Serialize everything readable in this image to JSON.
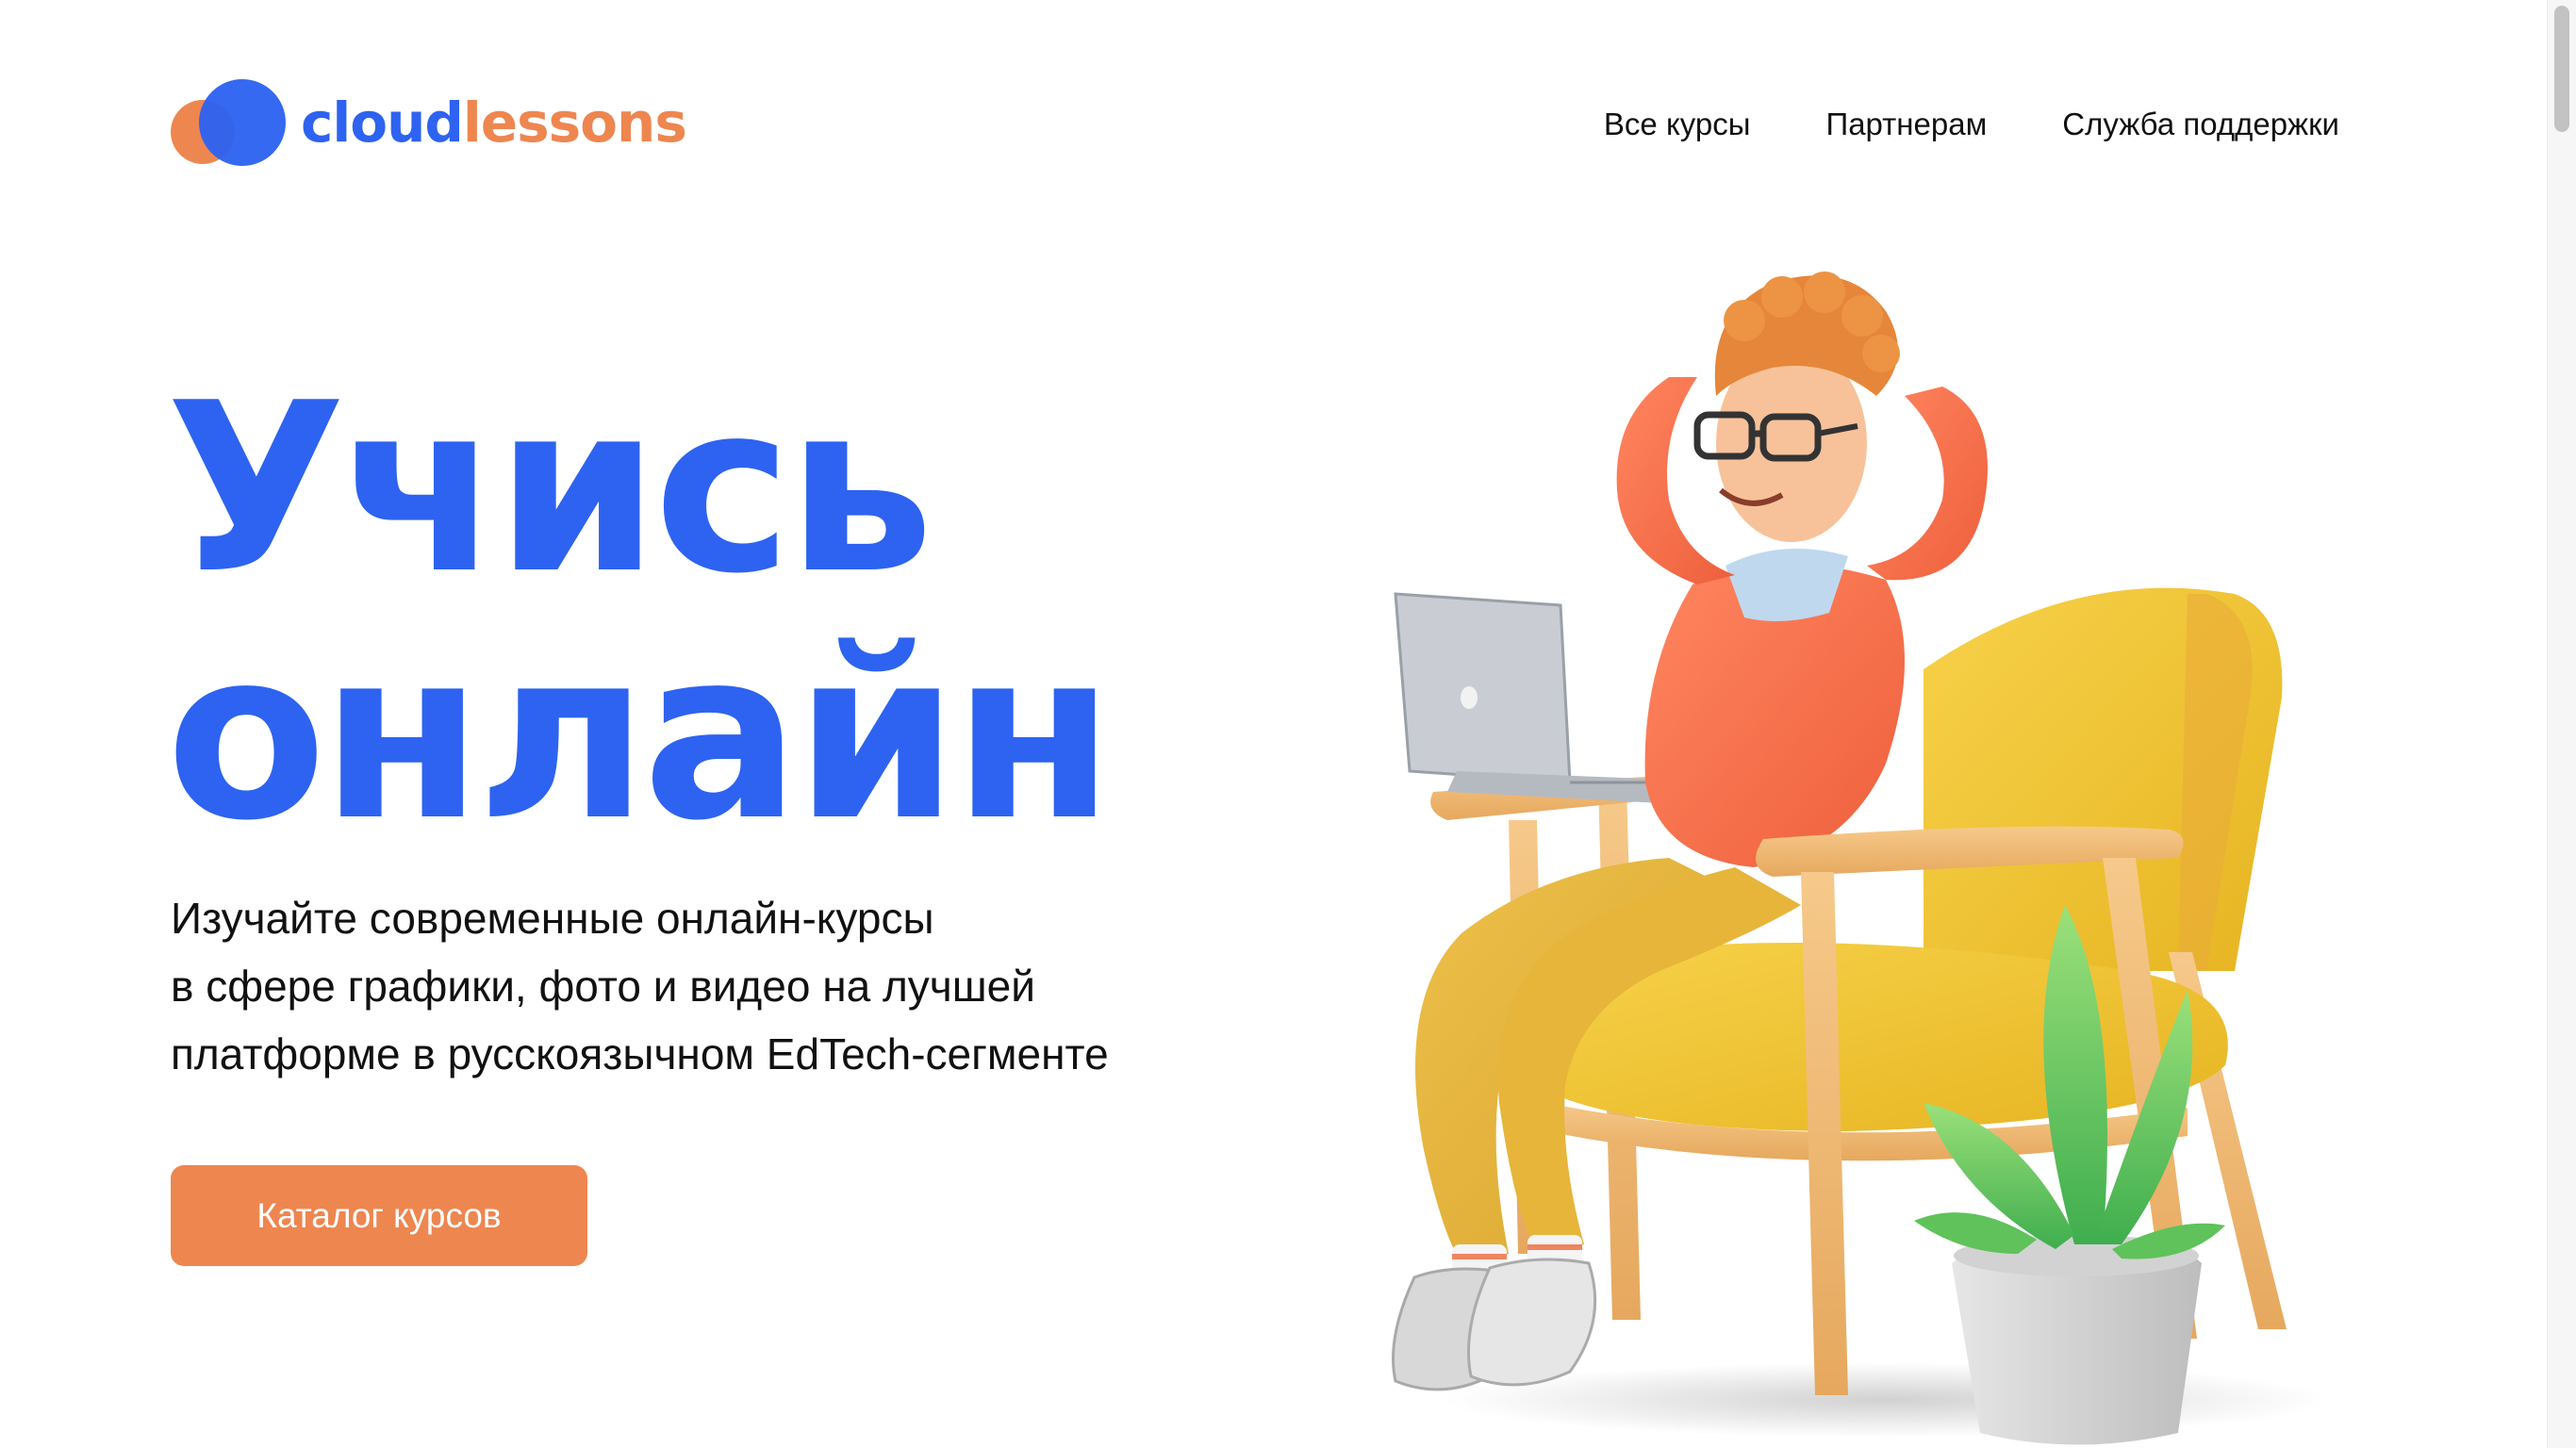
{
  "header": {
    "logo": {
      "part1": "cloud",
      "part2": "lessons",
      "icon": "two-overlapping-circles-logo-icon"
    },
    "nav": [
      {
        "label": "Все курсы"
      },
      {
        "label": "Партнерам"
      },
      {
        "label": "Служба поддержки"
      }
    ]
  },
  "hero": {
    "title_lines": [
      "Учись",
      "онлайн"
    ],
    "subtitle_lines": [
      "Изучайте современные онлайн-курсы",
      "в сфере графики, фото и видео на лучшей",
      "платформе в русскоязычном EdTech-сегменте"
    ],
    "cta_label": "Каталог курсов"
  },
  "illustration": {
    "description_icon": "man-relaxing-in-armchair-with-laptop-and-plant-illustration"
  },
  "colors": {
    "primary_blue": "#2D63F0",
    "accent_orange": "#EE8650",
    "text": "#111111",
    "background": "#FFFFFF"
  }
}
